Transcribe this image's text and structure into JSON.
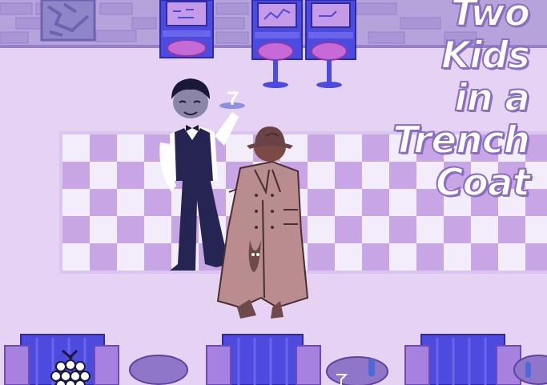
{
  "game": {
    "title_lines": [
      "Two",
      "Kids",
      "in a",
      "Trench",
      "Coat"
    ]
  },
  "palette": {
    "wall": "#9d8ed0",
    "floor": "#e6d3f3",
    "checker_dark": "#c8a6e6",
    "checker_light": "#f3ecfa",
    "arcade_blue": "#4d4ae0",
    "stool_pink": "#c56ad6",
    "coat": "#b98d8f",
    "waiter_suit": "#262452"
  },
  "icons": {
    "raspberry": "raspberry-icon"
  }
}
